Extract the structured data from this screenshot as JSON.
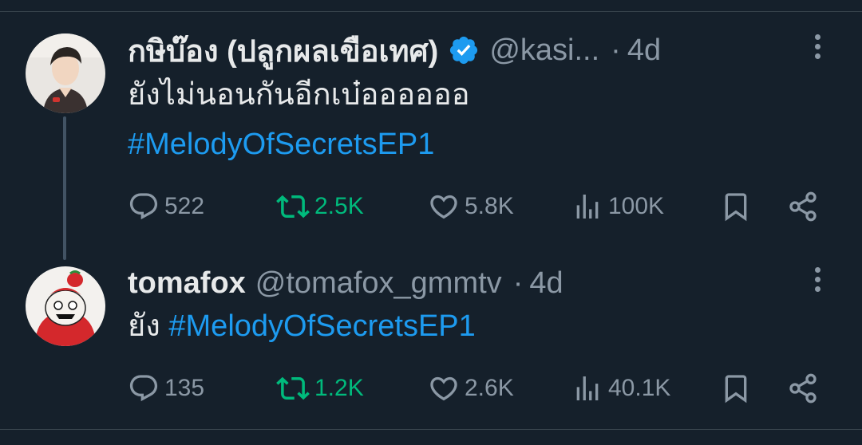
{
  "tweets": [
    {
      "name": "กษิบ๊อง (ปลูกผลเขือเทศ)",
      "verified": true,
      "handle": "@kasi...",
      "separator": "·",
      "time": "4d",
      "text_line1": "ยังไม่นอนกันอีกเบ๋ออออออ",
      "hashtag": "#MelodyOfSecretsEP1",
      "replies": "522",
      "retweets": "2.5K",
      "likes": "5.8K",
      "views": "100K"
    },
    {
      "name": "tomafox",
      "verified": false,
      "handle": "@tomafox_gmmtv",
      "separator": "·",
      "time": "4d",
      "text_prefix": "ยัง ",
      "hashtag": "#MelodyOfSecretsEP1",
      "replies": "135",
      "retweets": "1.2K",
      "likes": "2.6K",
      "views": "40.1K"
    }
  ],
  "colors": {
    "background": "#15202b",
    "text": "#e7e9ea",
    "muted": "#8b98a5",
    "accent": "#1d9bf0",
    "retweet": "#00ba7c"
  },
  "icons": [
    "reply-icon",
    "retweet-icon",
    "like-icon",
    "views-icon",
    "bookmark-icon",
    "share-icon",
    "more-icon",
    "verified-badge-icon"
  ]
}
